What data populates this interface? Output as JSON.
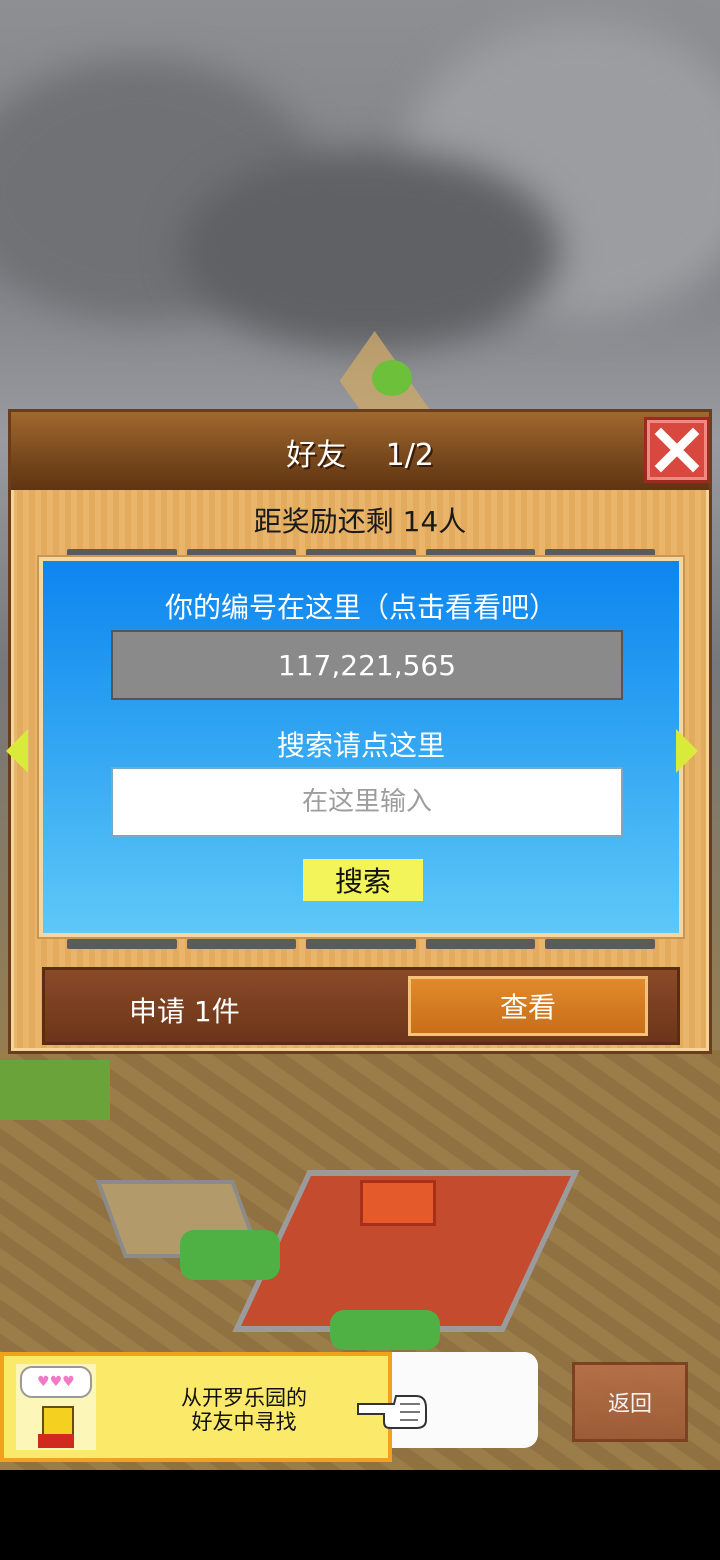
{
  "dialog": {
    "title": "好友　 1/2",
    "reward_status": "距奖励还剩 14人"
  },
  "profile": {
    "id_label": "你的编号在这里（点击看看吧）",
    "id_value": "117,221,565"
  },
  "search": {
    "label": "搜索请点这里",
    "placeholder": "在这里输入",
    "button_label": "搜索"
  },
  "requests": {
    "text": "申请 1件",
    "view_label": "查看"
  },
  "banner": {
    "text": "从开罗乐园的\n好友中寻找",
    "hearts": "♥♥♥"
  },
  "nav": {
    "back_label": "返回"
  },
  "colors": {
    "panel_blue": "#2ba0f2",
    "search_button": "#f2f45a",
    "close_red": "#d9483e",
    "view_orange": "#d47a22"
  }
}
